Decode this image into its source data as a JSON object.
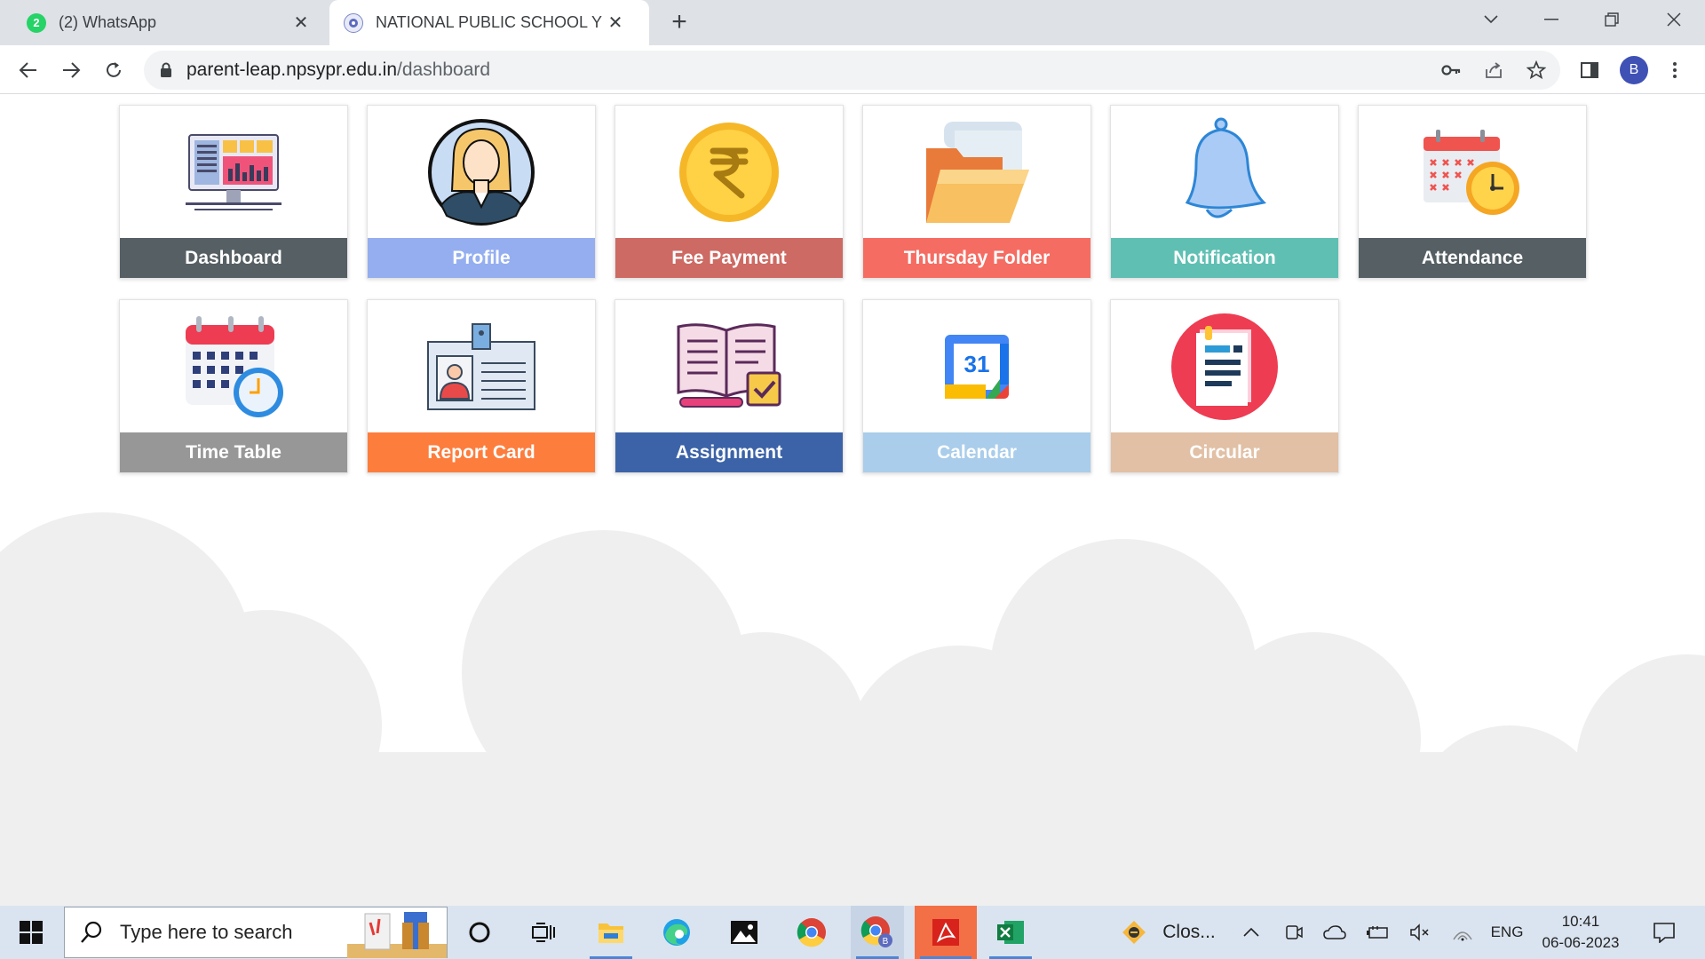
{
  "browser": {
    "tabs": [
      {
        "title": "(2) WhatsApp",
        "badge": "2"
      },
      {
        "title": "NATIONAL PUBLIC SCHOOL YESHWANTHPUR"
      }
    ],
    "url_host": "parent-leap.npsypr.edu.in",
    "url_path": "/dashboard",
    "profile_initial": "B"
  },
  "dashboard": {
    "tiles": [
      {
        "label": "Dashboard",
        "color": "#555f64",
        "icon": "monitor-analytics-icon"
      },
      {
        "label": "Profile",
        "color": "#94aef0",
        "icon": "woman-avatar-icon"
      },
      {
        "label": "Fee Payment",
        "color": "#cd6a63",
        "icon": "rupee-coin-icon"
      },
      {
        "label": "Thursday Folder",
        "color": "#f56c62",
        "icon": "folder-icon"
      },
      {
        "label": "Notification",
        "color": "#5fbfb3",
        "icon": "bell-icon"
      },
      {
        "label": "Attendance",
        "color": "#555f64",
        "icon": "calendar-clock-icon"
      },
      {
        "label": "Time Table",
        "color": "#979797",
        "icon": "timetable-icon"
      },
      {
        "label": "Report Card",
        "color": "#fd7d3d",
        "icon": "id-card-icon"
      },
      {
        "label": "Assignment",
        "color": "#3c63a7",
        "icon": "book-check-icon"
      },
      {
        "label": "Calendar",
        "color": "#a9cdea",
        "icon": "google-calendar-icon"
      },
      {
        "label": "Circular",
        "color": "#e1c0a5",
        "icon": "document-circle-icon"
      }
    ],
    "calendar_day": "31"
  },
  "taskbar": {
    "search_placeholder": "Type here to search",
    "tray_app_label": "Clos...",
    "language": "ENG",
    "time": "10:41",
    "date": "06-06-2023"
  }
}
